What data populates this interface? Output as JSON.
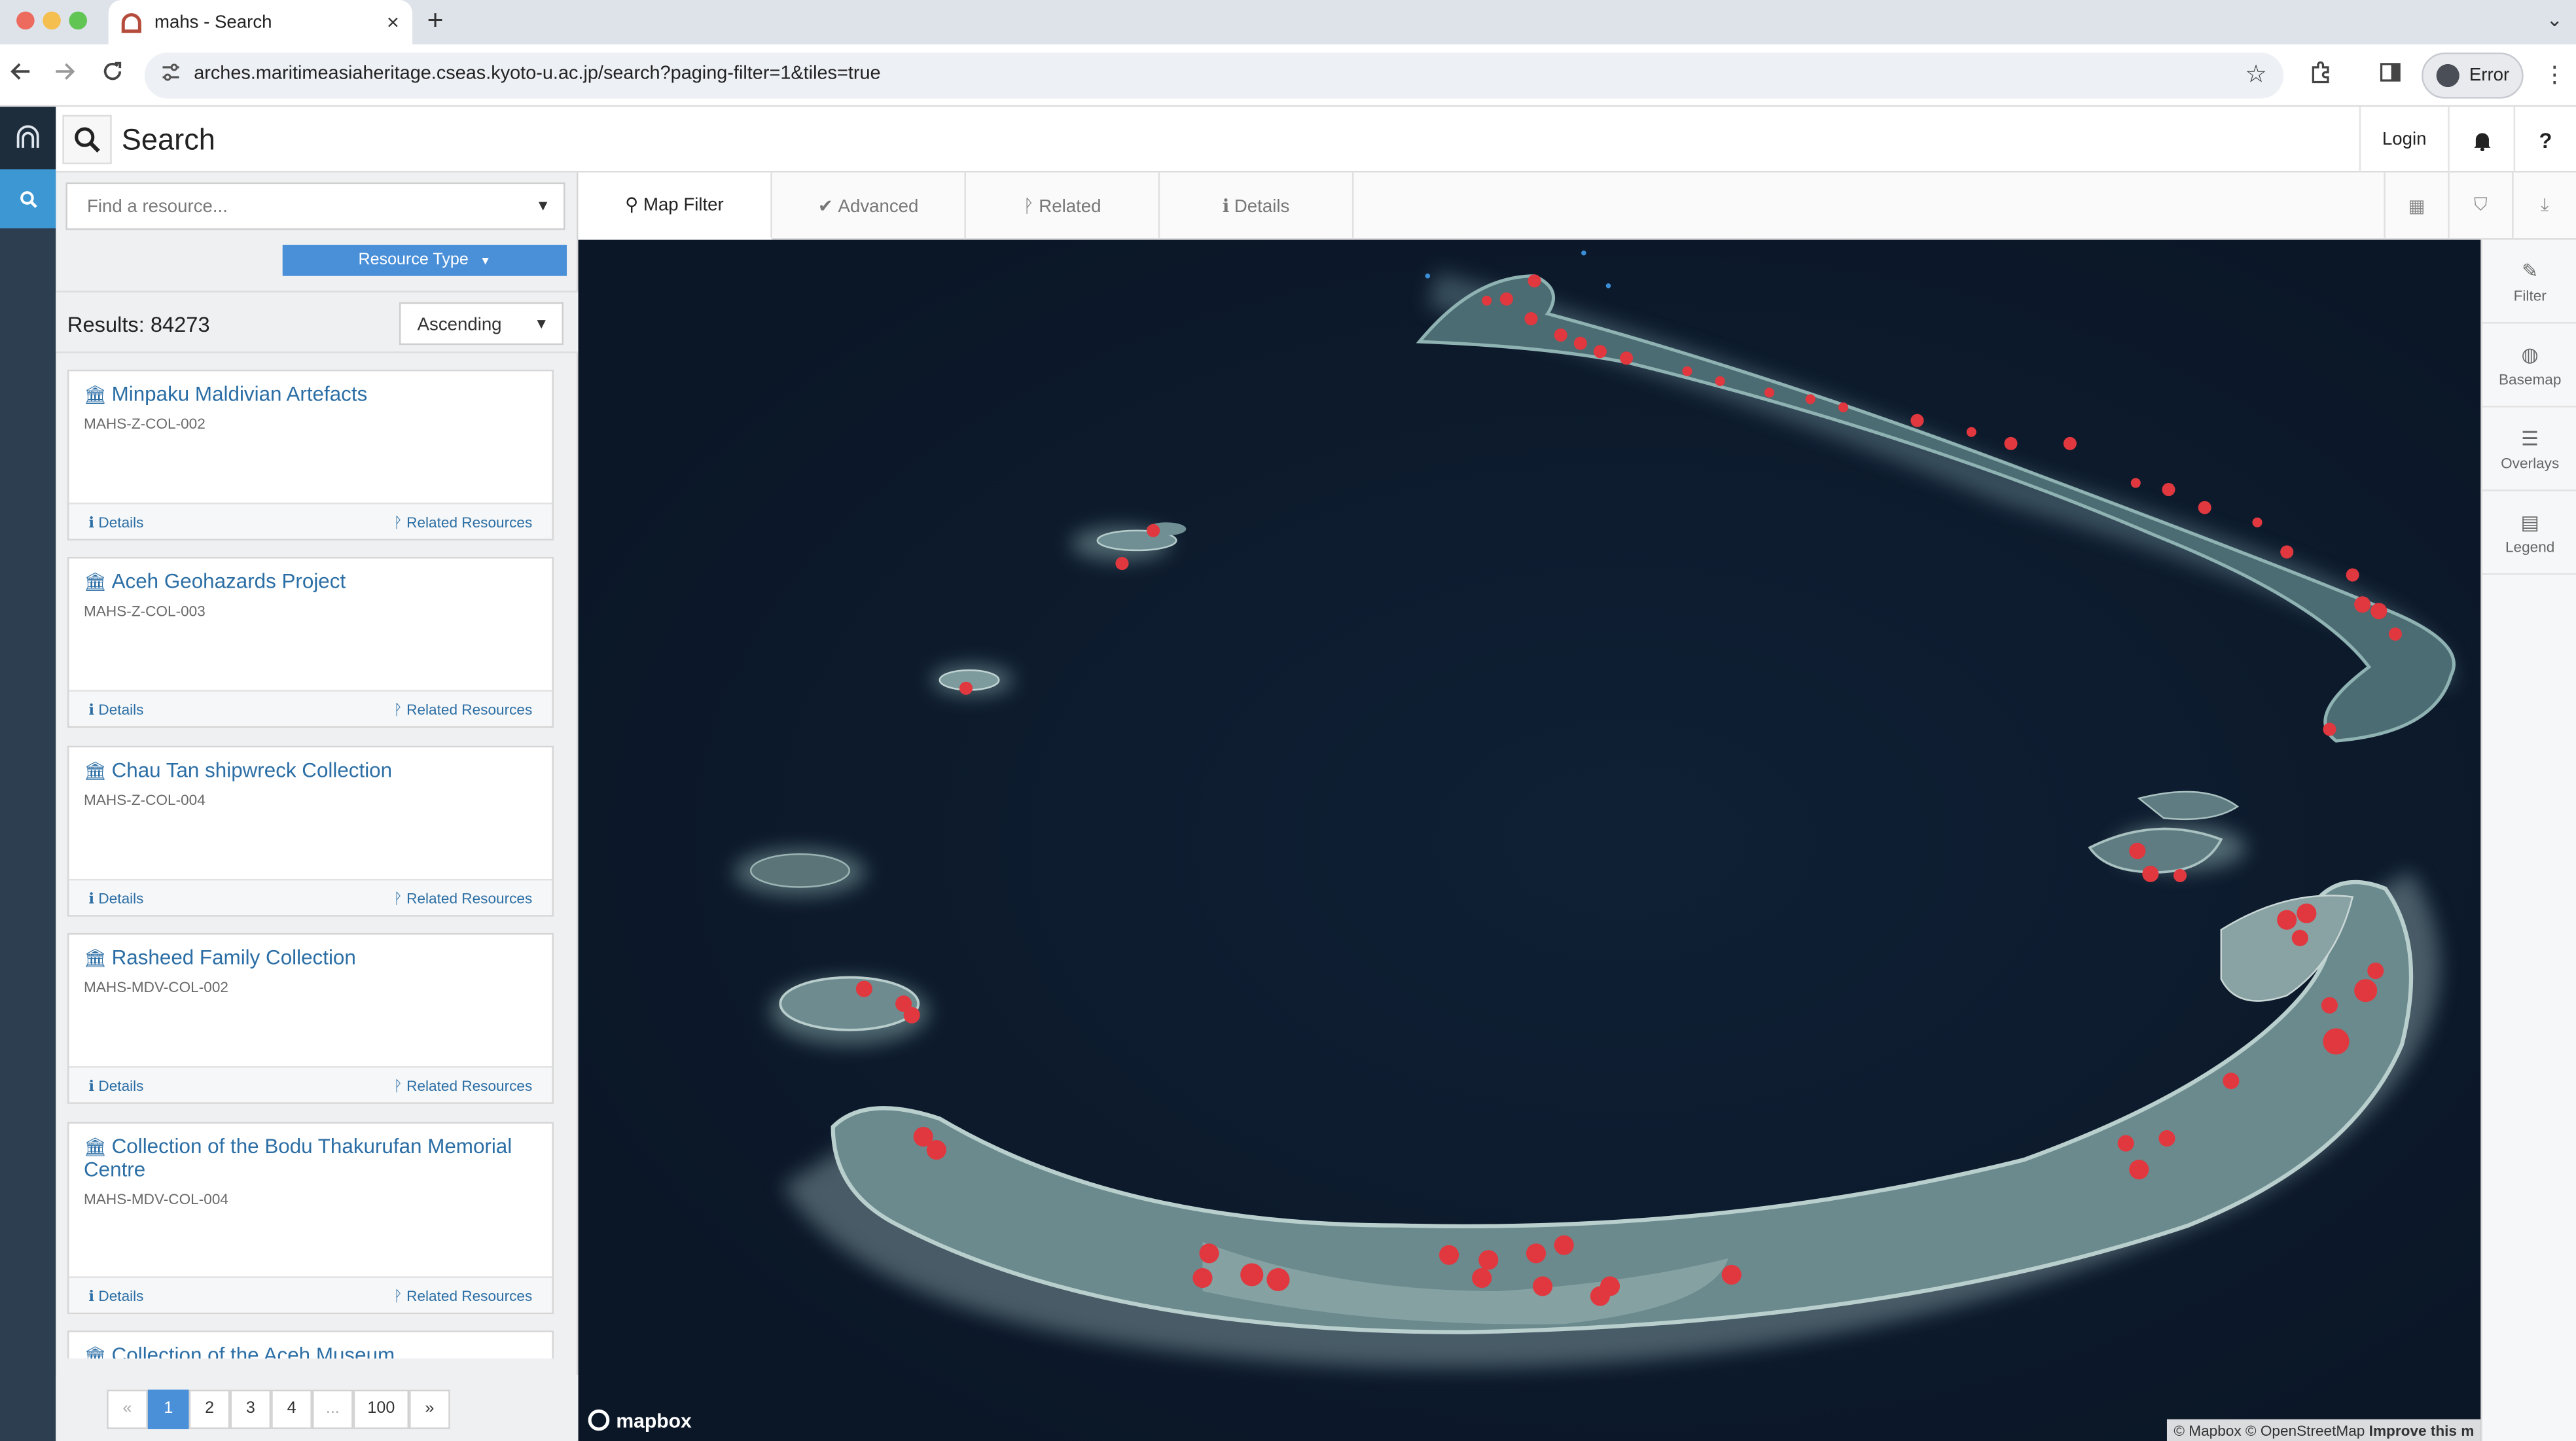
{
  "browser": {
    "tab_title": "mahs - Search",
    "close_glyph": "×",
    "newtab_glyph": "+",
    "tab_menu_glyph": "⌄",
    "url": "arches.maritimeasiaheritage.cseas.kyoto-u.ac.jp/search?paging-filter=1&tiles=true",
    "profile_label": "Error",
    "colors": {
      "tabbar": "#dee3ea",
      "traffic_red": "#ed6a5e",
      "traffic_yellow": "#f5bf4f",
      "traffic_green": "#61c554"
    }
  },
  "app": {
    "header_title": "Search",
    "login_label": "Login",
    "bell_icon": "bell-icon",
    "help_label": "?",
    "rail_colors": {
      "rail": "#2c3e50",
      "active": "#3d97d3"
    }
  },
  "search": {
    "placeholder": "Find a resource...",
    "resource_type_label": "Resource Type",
    "results_label": "Results: 84273",
    "sort_value": "Ascending"
  },
  "results": [
    {
      "title": "Minpaku Maldivian Artefacts",
      "id": "MAHS-Z-COL-002",
      "details": "Details",
      "related": "Related Resources"
    },
    {
      "title": "Aceh Geohazards Project",
      "id": "MAHS-Z-COL-003",
      "details": "Details",
      "related": "Related Resources"
    },
    {
      "title": "Chau Tan shipwreck Collection",
      "id": "MAHS-Z-COL-004",
      "details": "Details",
      "related": "Related Resources"
    },
    {
      "title": "Rasheed Family Collection",
      "id": "MAHS-MDV-COL-002",
      "details": "Details",
      "related": "Related Resources"
    },
    {
      "title": "Collection of the Bodu Thakurufan Memorial Centre",
      "id": "MAHS-MDV-COL-004",
      "details": "Details",
      "related": "Related Resources"
    },
    {
      "title": "Collection of the Aceh Museum",
      "id": "",
      "details": "",
      "related": ""
    }
  ],
  "pagination": {
    "prev": "«",
    "pages": [
      "1",
      "2",
      "3",
      "4",
      "...",
      "100"
    ],
    "next": "»",
    "current": "1"
  },
  "map_tabs": {
    "map_filter": "Map Filter",
    "advanced": "Advanced",
    "related": "Related",
    "details": "Details"
  },
  "map": {
    "logo": "mapbox",
    "attribution": "© Mapbox © OpenStreetMap",
    "improve": "Improve this m",
    "colors": {
      "ocean": "#0d1a2c",
      "marker": "#e0383e"
    }
  },
  "right_panel": {
    "filter": "Filter",
    "basemap": "Basemap",
    "overlays": "Overlays",
    "legend": "Legend"
  }
}
